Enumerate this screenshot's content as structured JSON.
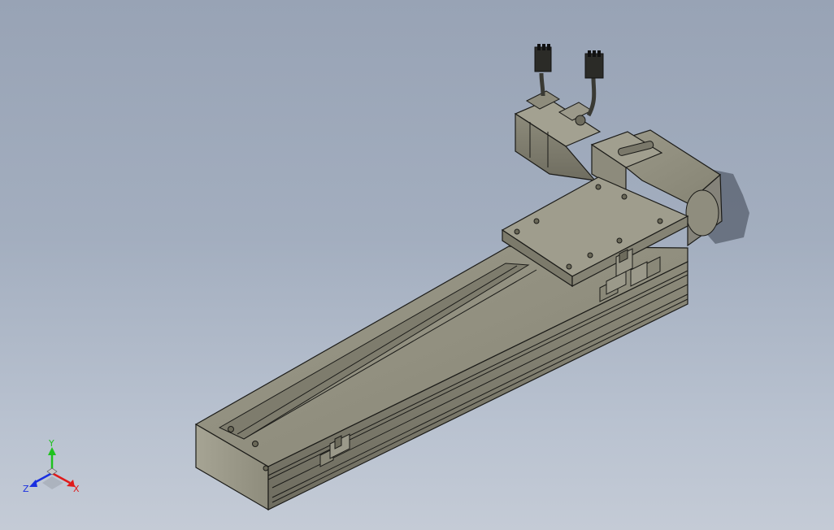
{
  "viewport": {
    "background_top": "#98a3b5",
    "background_bottom": "#c4cbd6"
  },
  "model": {
    "body_color": "#8c8a7a",
    "edge_color": "#1b1b18",
    "shadow_color": "#3d4350"
  },
  "triad": {
    "y_label": "Y",
    "x_label": "X",
    "z_label": "Z",
    "y_color": "#1ec21e",
    "x_color": "#e01a1a",
    "z_color": "#1a2fe0"
  }
}
